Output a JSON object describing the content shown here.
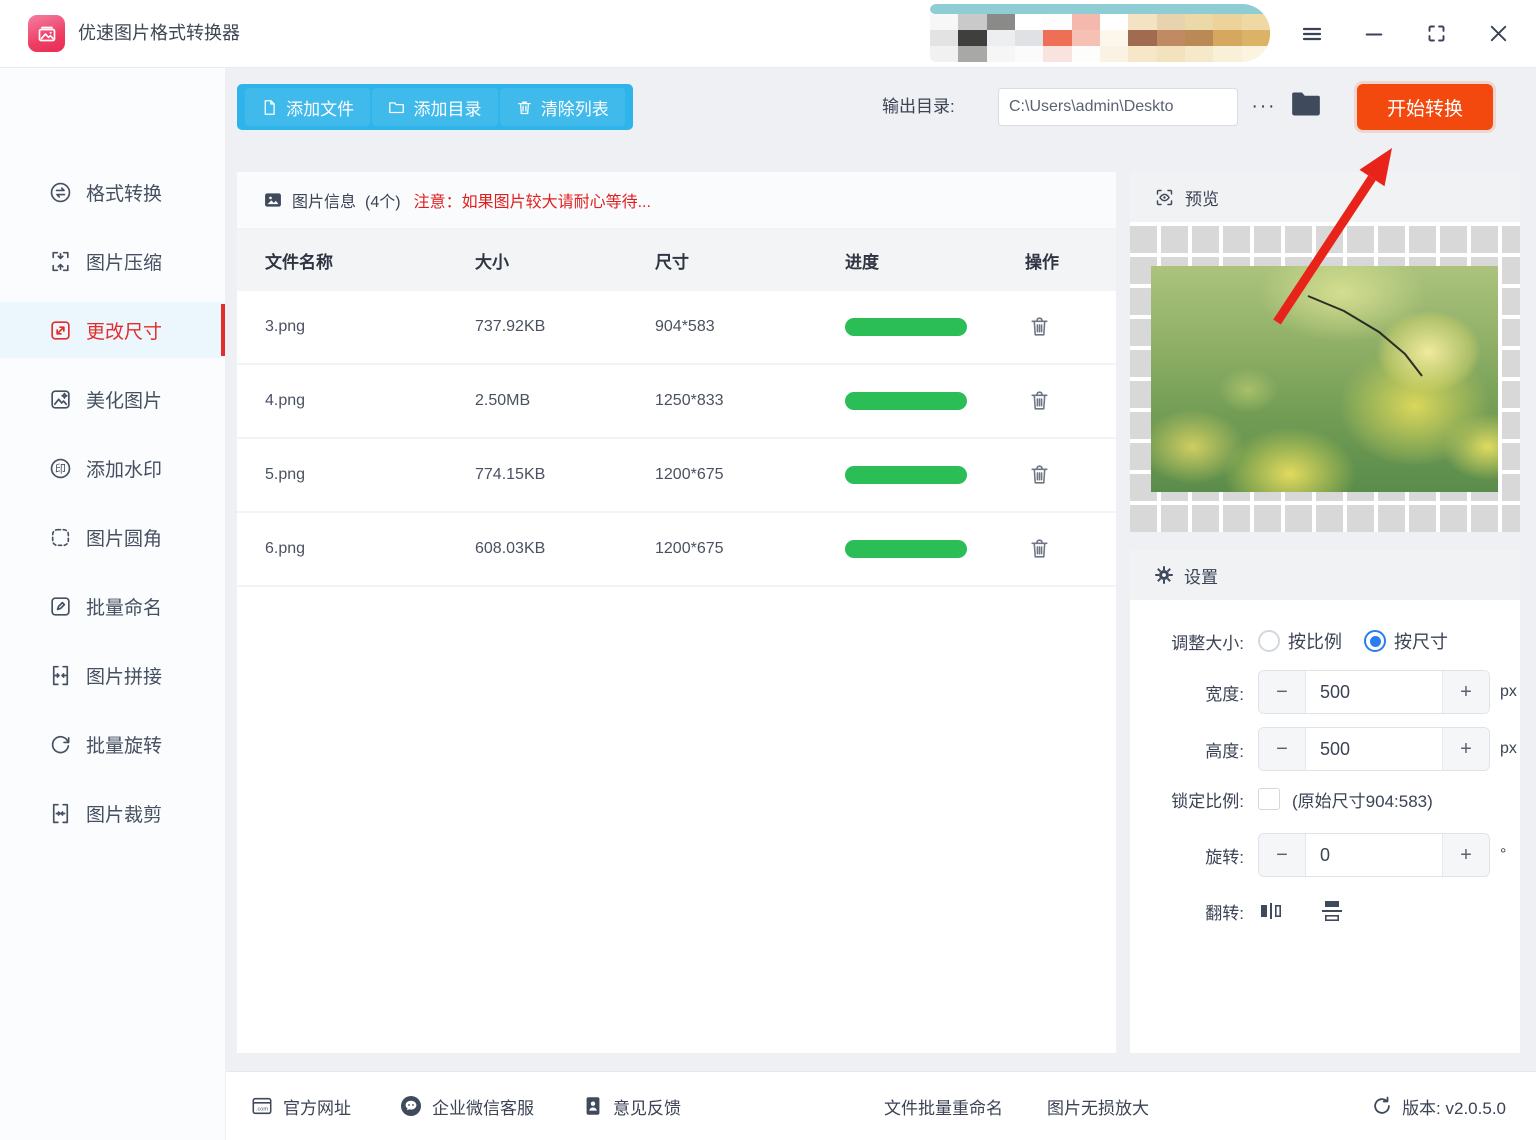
{
  "theme": {
    "accent_blue": "#2eb3ea",
    "accent_orange": "#f4490e",
    "progress_green": "#2cbe56",
    "alert_red": "#e02020",
    "active_red": "#e12d2d",
    "dark_icon": "#3f4a5c"
  },
  "titlebar": {
    "app_name": "优速图片格式转换器"
  },
  "toolbar": {
    "add_file": "添加文件",
    "add_dir": "添加目录",
    "clear_list": "清除列表",
    "output_label": "输出目录:",
    "output_value": "C:\\Users\\admin\\Deskto",
    "more": "···",
    "start": "开始转换"
  },
  "sidebar": {
    "items": [
      {
        "label": "格式转换",
        "icon": "format-convert",
        "active": false
      },
      {
        "label": "图片压缩",
        "icon": "image-compress",
        "active": false
      },
      {
        "label": "更改尺寸",
        "icon": "resize",
        "active": true
      },
      {
        "label": "美化图片",
        "icon": "beautify",
        "active": false
      },
      {
        "label": "添加水印",
        "icon": "watermark",
        "active": false
      },
      {
        "label": "图片圆角",
        "icon": "round-corner",
        "active": false
      },
      {
        "label": "批量命名",
        "icon": "batch-rename",
        "active": false
      },
      {
        "label": "图片拼接",
        "icon": "stitch",
        "active": false
      },
      {
        "label": "批量旋转",
        "icon": "batch-rotate",
        "active": false
      },
      {
        "label": "图片裁剪",
        "icon": "crop",
        "active": false
      }
    ]
  },
  "file_panel": {
    "info_title": "图片信息",
    "info_count": "(4个)",
    "notice": "注意：如果图片较大请耐心等待...",
    "columns": [
      "文件名称",
      "大小",
      "尺寸",
      "进度",
      "操作"
    ],
    "rows": [
      {
        "name": "3.png",
        "size": "737.92KB",
        "dimensions": "904*583",
        "progress": 100
      },
      {
        "name": "4.png",
        "size": "2.50MB",
        "dimensions": "1250*833",
        "progress": 100
      },
      {
        "name": "5.png",
        "size": "774.15KB",
        "dimensions": "1200*675",
        "progress": 100
      },
      {
        "name": "6.png",
        "size": "608.03KB",
        "dimensions": "1200*675",
        "progress": 100
      }
    ]
  },
  "preview": {
    "title": "预览"
  },
  "settings": {
    "title": "设置",
    "resize_mode_label": "调整大小:",
    "mode_ratio": "按比例",
    "mode_size": "按尺寸",
    "selected_mode": "按尺寸",
    "width_label": "宽度:",
    "width_value": "500",
    "width_unit": "px",
    "height_label": "高度:",
    "height_value": "500",
    "height_unit": "px",
    "lock_label": "锁定比例:",
    "lock_checked": false,
    "lock_hint": "(原始尺寸904:583)",
    "rotate_label": "旋转:",
    "rotate_value": "0",
    "rotate_unit": "°",
    "flip_label": "翻转:",
    "minus": "−",
    "plus": "+"
  },
  "footer": {
    "official_site": "官方网址",
    "wechat_service": "企业微信客服",
    "feedback": "意见反馈",
    "batch_file_rename": "文件批量重命名",
    "lossless_enlarge": "图片无损放大",
    "version": "版本: v2.0.5.0"
  },
  "censored_area": {
    "band": "#8ecdd3",
    "blocks": [
      [
        "#f7f7f7",
        "#c9c9c9",
        "#8a8a88",
        "#ffffff",
        "#fdfdfd",
        "#f4b8ac",
        "#ffffff",
        "#f3e3c2",
        "#e7d3ae",
        "#ecd9a8",
        "#edd39a",
        "#eed9a4"
      ],
      [
        "#e3e3e3",
        "#3f3f3d",
        "#eceef0",
        "#dfe1e4",
        "#ee6f55",
        "#f4c1b4",
        "#fdf6ea",
        "#a06b50",
        "#c08a62",
        "#b98a55",
        "#d6a75e",
        "#dcb267"
      ],
      [
        "#f1f1f1",
        "#a8a8a6",
        "#f6f6f6",
        "#fbfbfb",
        "#f9e3de",
        "#fdfdfb",
        "#faf3e3",
        "#f6e7c8",
        "#f3e3bd",
        "#f6e9c9",
        "#f9f0d8",
        "#fbf4e0"
      ]
    ]
  }
}
